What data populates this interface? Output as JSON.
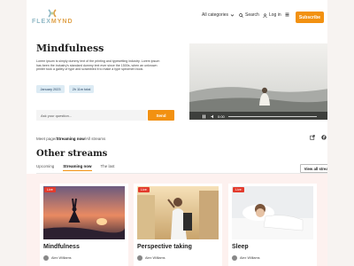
{
  "brand": {
    "part1": "FLEX",
    "part2": "MYND"
  },
  "header": {
    "categories_label": "All categories",
    "search_label": "Search",
    "login_label": "Log in",
    "subscribe_label": "Subscribe"
  },
  "hero": {
    "title": "Mindfulness",
    "description": "Lorem ipsum is simply dummy text of the printing and typesetting industry. Lorem ipsum has been the industry's standard dummy text ever since the 1500s, when an unknown printer took a galley of type and scrambled it to make a type specimen book.",
    "tags": [
      "January 2023",
      "2h 11m total"
    ],
    "question_placeholder": "Ask your question...",
    "send_label": "Send",
    "video_time": "0:00"
  },
  "breadcrumb": {
    "part1": "Meet page/",
    "part2": "Streaming now",
    "part3": "/All streams"
  },
  "social_icons": [
    "share-icon",
    "facebook-icon",
    "tiktok-icon",
    "instagram-icon"
  ],
  "other_streams": {
    "title": "Other streams",
    "tabs": [
      "Upcoming",
      "Streaming now",
      "The last"
    ],
    "active_tab": "Streaming now",
    "view_all_label": "View all streams →",
    "cards": [
      {
        "live": "Live",
        "title": "Mindfulness",
        "author": "Alex Williams"
      },
      {
        "live": "Live",
        "title": "Perspective taking",
        "author": "Alex Williams"
      },
      {
        "live": "Live",
        "title": "Sleep",
        "author": "Alex Williams"
      }
    ]
  },
  "colors": {
    "accent": "#f29111",
    "live": "#e33b2d",
    "tag_bg": "#dcebf4",
    "cards_bg": "#fdf1ef"
  }
}
